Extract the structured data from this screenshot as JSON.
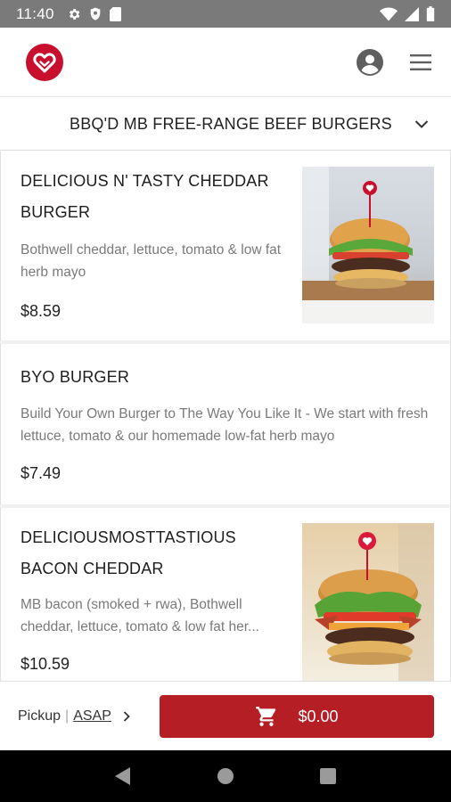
{
  "status_bar": {
    "time": "11:40",
    "icons_left": [
      "gear-icon",
      "shield-icon",
      "sd-card-icon"
    ],
    "icons_right": [
      "wifi-icon",
      "signal-icon",
      "battery-icon"
    ]
  },
  "header": {
    "logo": "heart-logo",
    "account_icon": "account-circle-icon",
    "menu_icon": "hamburger-menu-icon"
  },
  "category": {
    "title": "BBQ'D MB FREE-RANGE BEEF BURGERS",
    "chevron": "chevron-down-icon"
  },
  "items": [
    {
      "name": "DELICIOUS N' TASTY CHEDDAR BURGER",
      "description": "Bothwell cheddar, lettuce, tomato & low fat herb mayo",
      "price": "$8.59",
      "has_photo": true
    },
    {
      "name": "BYO BURGER",
      "description": "Build Your Own Burger to The Way You Like It - We start with fresh lettuce, tomato & our homemade low-fat herb mayo",
      "price": "$7.49",
      "has_photo": false
    },
    {
      "name": "DELICIOUSMOSTTASTIOUS BACON CHEDDAR",
      "description_line1": "MB bacon (smoked + rwa), Bothwell",
      "description_line2": "cheddar, lettuce, tomato & low fat her...",
      "price": "$10.59",
      "has_photo": true
    }
  ],
  "footer": {
    "pickup_label": "Pickup",
    "separator": "|",
    "pickup_time": "ASAP",
    "cart_total": "$0.00",
    "cart_icon": "shopping-cart-icon"
  },
  "colors": {
    "brand_red": "#c8102e",
    "button_red": "#b51e24",
    "status_bar": "#7a7a7a"
  }
}
